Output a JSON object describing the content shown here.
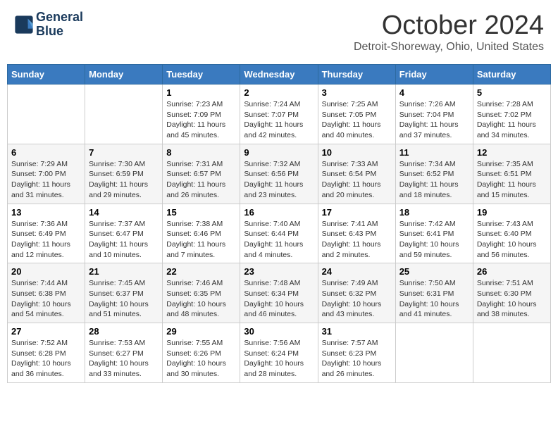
{
  "header": {
    "logo_line1": "General",
    "logo_line2": "Blue",
    "month": "October 2024",
    "location": "Detroit-Shoreway, Ohio, United States"
  },
  "days_of_week": [
    "Sunday",
    "Monday",
    "Tuesday",
    "Wednesday",
    "Thursday",
    "Friday",
    "Saturday"
  ],
  "weeks": [
    [
      {
        "day": "",
        "sunrise": "",
        "sunset": "",
        "daylight": ""
      },
      {
        "day": "",
        "sunrise": "",
        "sunset": "",
        "daylight": ""
      },
      {
        "day": "1",
        "sunrise": "Sunrise: 7:23 AM",
        "sunset": "Sunset: 7:09 PM",
        "daylight": "Daylight: 11 hours and 45 minutes."
      },
      {
        "day": "2",
        "sunrise": "Sunrise: 7:24 AM",
        "sunset": "Sunset: 7:07 PM",
        "daylight": "Daylight: 11 hours and 42 minutes."
      },
      {
        "day": "3",
        "sunrise": "Sunrise: 7:25 AM",
        "sunset": "Sunset: 7:05 PM",
        "daylight": "Daylight: 11 hours and 40 minutes."
      },
      {
        "day": "4",
        "sunrise": "Sunrise: 7:26 AM",
        "sunset": "Sunset: 7:04 PM",
        "daylight": "Daylight: 11 hours and 37 minutes."
      },
      {
        "day": "5",
        "sunrise": "Sunrise: 7:28 AM",
        "sunset": "Sunset: 7:02 PM",
        "daylight": "Daylight: 11 hours and 34 minutes."
      }
    ],
    [
      {
        "day": "6",
        "sunrise": "Sunrise: 7:29 AM",
        "sunset": "Sunset: 7:00 PM",
        "daylight": "Daylight: 11 hours and 31 minutes."
      },
      {
        "day": "7",
        "sunrise": "Sunrise: 7:30 AM",
        "sunset": "Sunset: 6:59 PM",
        "daylight": "Daylight: 11 hours and 29 minutes."
      },
      {
        "day": "8",
        "sunrise": "Sunrise: 7:31 AM",
        "sunset": "Sunset: 6:57 PM",
        "daylight": "Daylight: 11 hours and 26 minutes."
      },
      {
        "day": "9",
        "sunrise": "Sunrise: 7:32 AM",
        "sunset": "Sunset: 6:56 PM",
        "daylight": "Daylight: 11 hours and 23 minutes."
      },
      {
        "day": "10",
        "sunrise": "Sunrise: 7:33 AM",
        "sunset": "Sunset: 6:54 PM",
        "daylight": "Daylight: 11 hours and 20 minutes."
      },
      {
        "day": "11",
        "sunrise": "Sunrise: 7:34 AM",
        "sunset": "Sunset: 6:52 PM",
        "daylight": "Daylight: 11 hours and 18 minutes."
      },
      {
        "day": "12",
        "sunrise": "Sunrise: 7:35 AM",
        "sunset": "Sunset: 6:51 PM",
        "daylight": "Daylight: 11 hours and 15 minutes."
      }
    ],
    [
      {
        "day": "13",
        "sunrise": "Sunrise: 7:36 AM",
        "sunset": "Sunset: 6:49 PM",
        "daylight": "Daylight: 11 hours and 12 minutes."
      },
      {
        "day": "14",
        "sunrise": "Sunrise: 7:37 AM",
        "sunset": "Sunset: 6:47 PM",
        "daylight": "Daylight: 11 hours and 10 minutes."
      },
      {
        "day": "15",
        "sunrise": "Sunrise: 7:38 AM",
        "sunset": "Sunset: 6:46 PM",
        "daylight": "Daylight: 11 hours and 7 minutes."
      },
      {
        "day": "16",
        "sunrise": "Sunrise: 7:40 AM",
        "sunset": "Sunset: 6:44 PM",
        "daylight": "Daylight: 11 hours and 4 minutes."
      },
      {
        "day": "17",
        "sunrise": "Sunrise: 7:41 AM",
        "sunset": "Sunset: 6:43 PM",
        "daylight": "Daylight: 11 hours and 2 minutes."
      },
      {
        "day": "18",
        "sunrise": "Sunrise: 7:42 AM",
        "sunset": "Sunset: 6:41 PM",
        "daylight": "Daylight: 10 hours and 59 minutes."
      },
      {
        "day": "19",
        "sunrise": "Sunrise: 7:43 AM",
        "sunset": "Sunset: 6:40 PM",
        "daylight": "Daylight: 10 hours and 56 minutes."
      }
    ],
    [
      {
        "day": "20",
        "sunrise": "Sunrise: 7:44 AM",
        "sunset": "Sunset: 6:38 PM",
        "daylight": "Daylight: 10 hours and 54 minutes."
      },
      {
        "day": "21",
        "sunrise": "Sunrise: 7:45 AM",
        "sunset": "Sunset: 6:37 PM",
        "daylight": "Daylight: 10 hours and 51 minutes."
      },
      {
        "day": "22",
        "sunrise": "Sunrise: 7:46 AM",
        "sunset": "Sunset: 6:35 PM",
        "daylight": "Daylight: 10 hours and 48 minutes."
      },
      {
        "day": "23",
        "sunrise": "Sunrise: 7:48 AM",
        "sunset": "Sunset: 6:34 PM",
        "daylight": "Daylight: 10 hours and 46 minutes."
      },
      {
        "day": "24",
        "sunrise": "Sunrise: 7:49 AM",
        "sunset": "Sunset: 6:32 PM",
        "daylight": "Daylight: 10 hours and 43 minutes."
      },
      {
        "day": "25",
        "sunrise": "Sunrise: 7:50 AM",
        "sunset": "Sunset: 6:31 PM",
        "daylight": "Daylight: 10 hours and 41 minutes."
      },
      {
        "day": "26",
        "sunrise": "Sunrise: 7:51 AM",
        "sunset": "Sunset: 6:30 PM",
        "daylight": "Daylight: 10 hours and 38 minutes."
      }
    ],
    [
      {
        "day": "27",
        "sunrise": "Sunrise: 7:52 AM",
        "sunset": "Sunset: 6:28 PM",
        "daylight": "Daylight: 10 hours and 36 minutes."
      },
      {
        "day": "28",
        "sunrise": "Sunrise: 7:53 AM",
        "sunset": "Sunset: 6:27 PM",
        "daylight": "Daylight: 10 hours and 33 minutes."
      },
      {
        "day": "29",
        "sunrise": "Sunrise: 7:55 AM",
        "sunset": "Sunset: 6:26 PM",
        "daylight": "Daylight: 10 hours and 30 minutes."
      },
      {
        "day": "30",
        "sunrise": "Sunrise: 7:56 AM",
        "sunset": "Sunset: 6:24 PM",
        "daylight": "Daylight: 10 hours and 28 minutes."
      },
      {
        "day": "31",
        "sunrise": "Sunrise: 7:57 AM",
        "sunset": "Sunset: 6:23 PM",
        "daylight": "Daylight: 10 hours and 26 minutes."
      },
      {
        "day": "",
        "sunrise": "",
        "sunset": "",
        "daylight": ""
      },
      {
        "day": "",
        "sunrise": "",
        "sunset": "",
        "daylight": ""
      }
    ]
  ]
}
